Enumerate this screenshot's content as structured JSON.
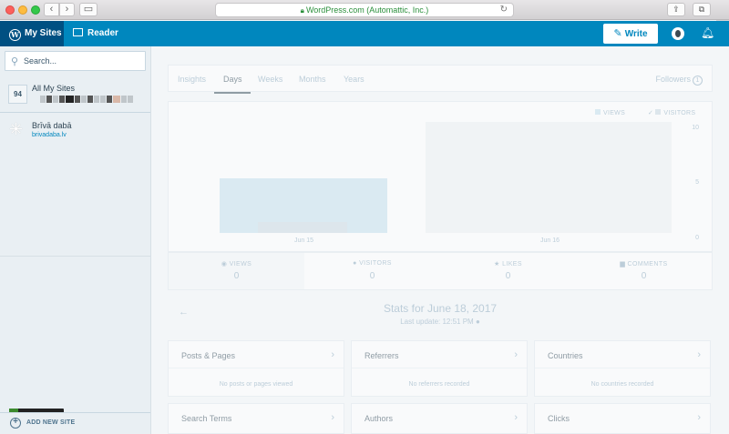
{
  "browser": {
    "url_text": "WordPress.com (Automattic, Inc.)",
    "back_icon": "chevron-left-icon",
    "forward_icon": "chevron-right-icon"
  },
  "masterbar": {
    "my_sites_label": "My Sites",
    "reader_label": "Reader",
    "write_label": "Write"
  },
  "sidebar": {
    "search_placeholder": "Search...",
    "all_sites": {
      "count": "94",
      "label": "All My Sites"
    },
    "sites": [
      {
        "name": "Brīvā dabā",
        "url": "brivadaba.lv"
      }
    ],
    "add_site_label": "ADD NEW SITE"
  },
  "stats": {
    "tabs": [
      {
        "label": "Insights"
      },
      {
        "label": "Days"
      },
      {
        "label": "Weeks"
      },
      {
        "label": "Months"
      },
      {
        "label": "Years"
      }
    ],
    "active_tab": "Days",
    "followers_label": "Followers",
    "followers_count": "1",
    "legend": {
      "views": "VIEWS",
      "visitors": "VISITORS"
    },
    "summary": [
      {
        "label": "VIEWS",
        "value": "0"
      },
      {
        "label": "VISITORS",
        "value": "0"
      },
      {
        "label": "LIKES",
        "value": "0"
      },
      {
        "label": "COMMENTS",
        "value": "0"
      }
    ],
    "period_title": "Stats for June 18, 2017",
    "last_update": "Last update: 12:51 PM",
    "modules": [
      {
        "title": "Posts & Pages",
        "empty": "No posts or pages viewed"
      },
      {
        "title": "Referrers",
        "empty": "No referrers recorded"
      },
      {
        "title": "Countries",
        "empty": "No countries recorded"
      },
      {
        "title": "Search Terms",
        "empty": ""
      },
      {
        "title": "Authors",
        "empty": ""
      },
      {
        "title": "Clicks",
        "empty": ""
      }
    ]
  },
  "chart_data": {
    "type": "bar",
    "categories": [
      "Jun 15",
      "Jun 16"
    ],
    "series": [
      {
        "name": "VIEWS",
        "values": [
          0,
          0
        ]
      },
      {
        "name": "VISITORS",
        "values": [
          0,
          0
        ]
      }
    ],
    "yticks": [
      "10",
      "5",
      "0"
    ],
    "ylim": [
      0,
      10
    ],
    "colors": {
      "views": "#c3e0ed",
      "visitors": "#c8d7e1"
    }
  }
}
